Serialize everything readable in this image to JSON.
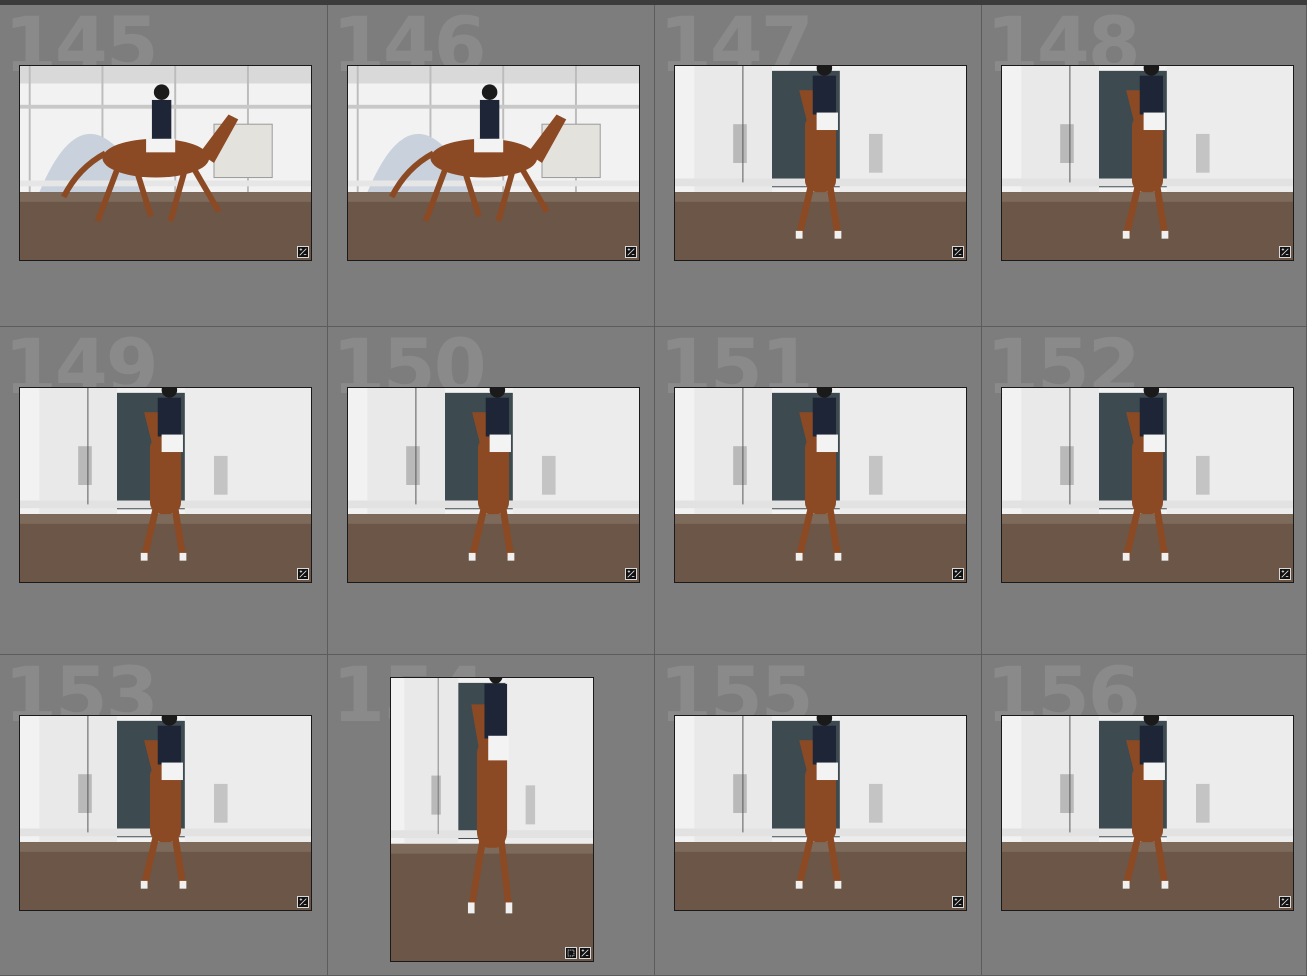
{
  "grid": {
    "cells": [
      {
        "index": "145",
        "orientation": "landscape",
        "scene": "side"
      },
      {
        "index": "146",
        "orientation": "landscape",
        "scene": "side"
      },
      {
        "index": "147",
        "orientation": "landscape",
        "scene": "front"
      },
      {
        "index": "148",
        "orientation": "landscape",
        "scene": "front"
      },
      {
        "index": "149",
        "orientation": "landscape",
        "scene": "front"
      },
      {
        "index": "150",
        "orientation": "landscape",
        "scene": "front"
      },
      {
        "index": "151",
        "orientation": "landscape",
        "scene": "front"
      },
      {
        "index": "152",
        "orientation": "landscape",
        "scene": "front"
      },
      {
        "index": "153",
        "orientation": "landscape",
        "scene": "front"
      },
      {
        "index": "154",
        "orientation": "portrait",
        "scene": "front"
      },
      {
        "index": "155",
        "orientation": "landscape",
        "scene": "front"
      },
      {
        "index": "156",
        "orientation": "landscape",
        "scene": "front"
      }
    ]
  },
  "icons": {
    "badge": "develop-adjustment-icon",
    "crop_badge": "crop-icon"
  },
  "colors": {
    "cell_bg": "#7d7d7d",
    "index_text": "#8a8a8a",
    "horse": "#8b4a24",
    "arena_dirt": "#6b5647",
    "sky": "#f2f2f2"
  }
}
